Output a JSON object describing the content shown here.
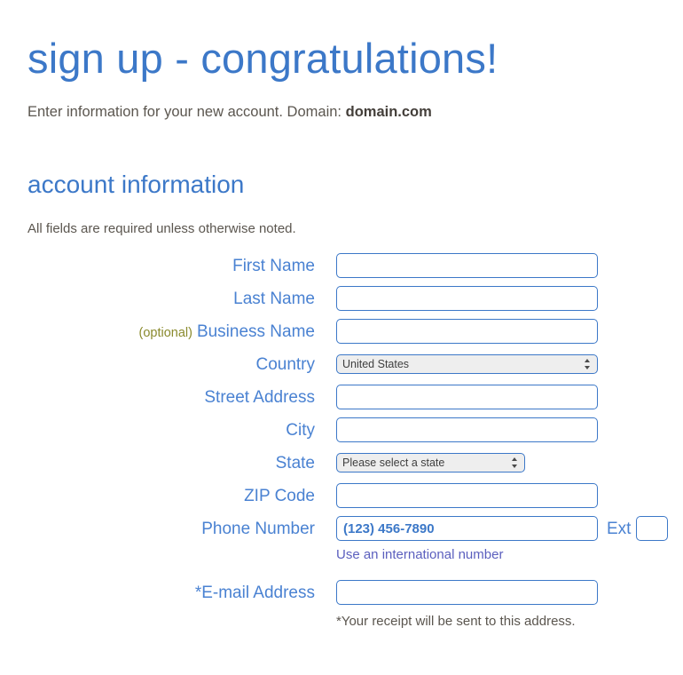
{
  "header": {
    "title": "sign up - congratulations!",
    "intro_prefix": "Enter information for your new account. Domain:",
    "domain": "domain.com"
  },
  "section": {
    "title": "account information",
    "required_note": "All fields are required unless otherwise noted."
  },
  "form": {
    "fields": [
      {
        "label": "First Name",
        "value": "",
        "type": "text"
      },
      {
        "label": "Last Name",
        "value": "",
        "type": "text"
      },
      {
        "optional_tag": "(optional)",
        "label": "Business Name",
        "value": "",
        "type": "text"
      },
      {
        "label": "Country",
        "value": "United States",
        "type": "select"
      },
      {
        "label": "Street Address",
        "value": "",
        "type": "text"
      },
      {
        "label": "City",
        "value": "",
        "type": "text"
      },
      {
        "label": "State",
        "value": "Please select a state",
        "type": "select"
      },
      {
        "label": "ZIP Code",
        "value": "",
        "type": "text"
      },
      {
        "label": "Phone Number",
        "value": "",
        "placeholder": "(123) 456-7890",
        "type": "text"
      },
      {
        "label": "*E-mail Address",
        "value": "",
        "type": "text"
      }
    ],
    "ext_label": "Ext",
    "ext_value": "",
    "international_link": "Use an international number",
    "email_note": "*Your receipt will be sent to this address."
  },
  "colors": {
    "accent_blue": "#3c78c8",
    "label_blue": "#4a82d2",
    "optional_olive": "#8a8a2d",
    "body_gray": "#5b564f",
    "link_violet": "#5b5fbe"
  }
}
